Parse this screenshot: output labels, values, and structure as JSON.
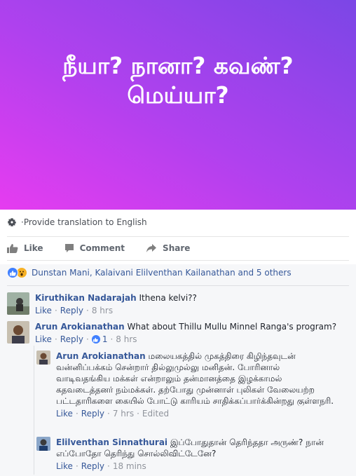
{
  "banner": {
    "text_line1": "நீயா? நானா? கவண்?",
    "text_line2": "மெய்யா?",
    "colors": {
      "start": "#e63cf0",
      "end": "#7b46e6"
    }
  },
  "translation": {
    "prefix": "· ",
    "link": "Provide translation to English"
  },
  "actions": {
    "like": "Like",
    "comment": "Comment",
    "share": "Share"
  },
  "reactions": {
    "names": "Dunstan Mani, Kalaivani Elilventhan Kailanathan and 5 others"
  },
  "comments": [
    {
      "name": "Kiruthikan Nadarajah",
      "text": "Ithena kelvi??",
      "like": "Like",
      "reply": "Reply",
      "time": "8 hrs"
    },
    {
      "name": "Arun Arokianathan",
      "text": "What about Thillu Mullu Minnel Ranga's program?",
      "like": "Like",
      "reply": "Reply",
      "likes_count": "1",
      "time": "8 hrs"
    }
  ],
  "replies": [
    {
      "name": "Arun Arokianathan",
      "text": "மலையகத்தில் முகத்திரை கிழிந்தவுடன் வன்னிப்பக்கம் சென்றார் தில்லுமுல்லு மனிதன். போரினால் வாடிவதங்கிய மக்கள் என்றாலும் தன்மானத்தை இழக்காமல் கதவடைத்தனர் நம்மக்கள். தற்போது முன்னாள் புலிகள் வேலையற்ற பட்டதாரிகளை கையில் போட்டு காரியம் சாதிக்கப்பார்க்கின்றது குள்ளநரி.",
      "like": "Like",
      "reply": "Reply",
      "time": "7 hrs",
      "edited": "Edited"
    },
    {
      "name": "Elilventhan Sinnathurai",
      "text": "இப்போதுதான் தெரிந்ததா அருண்? நான் எப்போதோ தெரிந்து சொல்லிவிட்டேனே?",
      "like": "Like",
      "reply": "Reply",
      "time": "18 mins"
    }
  ],
  "colors": {
    "link": "#365899",
    "meta": "#90949c",
    "like_blue": "#4080ff"
  }
}
